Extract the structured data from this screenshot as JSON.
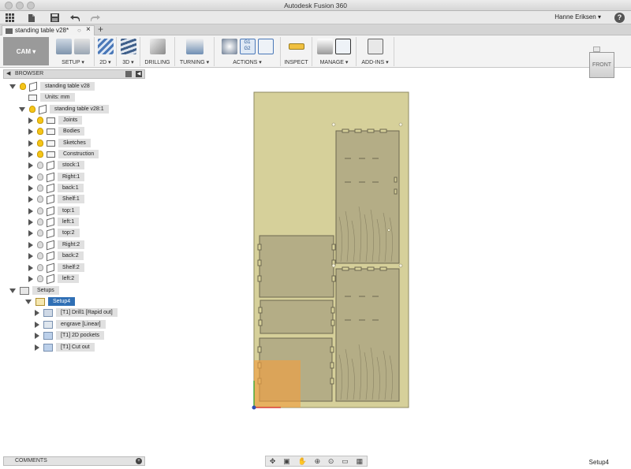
{
  "window": {
    "title": "Autodesk Fusion 360"
  },
  "quickbar": {
    "user_name": "Hanne Eriksen ▾",
    "help_label": "?",
    "icons": [
      "grid-icon",
      "file-icon",
      "save-icon",
      "undo-icon",
      "redo-icon"
    ]
  },
  "document_tab": {
    "label": "standing table v28*",
    "close": "×",
    "add": "+"
  },
  "toolbar": {
    "workspace": "CAM ▾",
    "groups": [
      {
        "label": "SETUP ▾"
      },
      {
        "label": "2D ▾"
      },
      {
        "label": "3D ▾"
      },
      {
        "label": "DRILLING"
      },
      {
        "label": "TURNING ▾"
      },
      {
        "label": "ACTIONS ▾",
        "g1g2_top": "G1",
        "g1g2_bottom": "G2"
      },
      {
        "label": "INSPECT"
      },
      {
        "label": "MANAGE ▾"
      },
      {
        "label": "ADD-INS ▾"
      }
    ]
  },
  "viewcube": {
    "face": "FRONT"
  },
  "browser": {
    "title": "BROWSER",
    "root": "standing table v28",
    "units": "Units: mm",
    "component": "standing table v28:1",
    "folders": [
      "Joints",
      "Bodies",
      "Sketches",
      "Construction"
    ],
    "bodies": [
      "stock:1",
      "Right:1",
      "back:1",
      "Shelf:1",
      "top:1",
      "left:1",
      "top:2",
      "Right:2",
      "back:2",
      "Shelf:2",
      "left:2"
    ],
    "setups_label": "Setups",
    "setup": "Setup4",
    "operations": [
      "[T1] Drill1 [Rapid out]",
      "engrave [Linear]",
      "[T1] 2D pockets",
      "[T1] Cut out"
    ]
  },
  "comments": {
    "label": "COMMENTS"
  },
  "status": {
    "active": "Setup4"
  },
  "colors": {
    "stock": "#d6d09a",
    "panel": "#b4ad86",
    "selection": "#2f6fb5",
    "highlight": "#f0a040"
  }
}
